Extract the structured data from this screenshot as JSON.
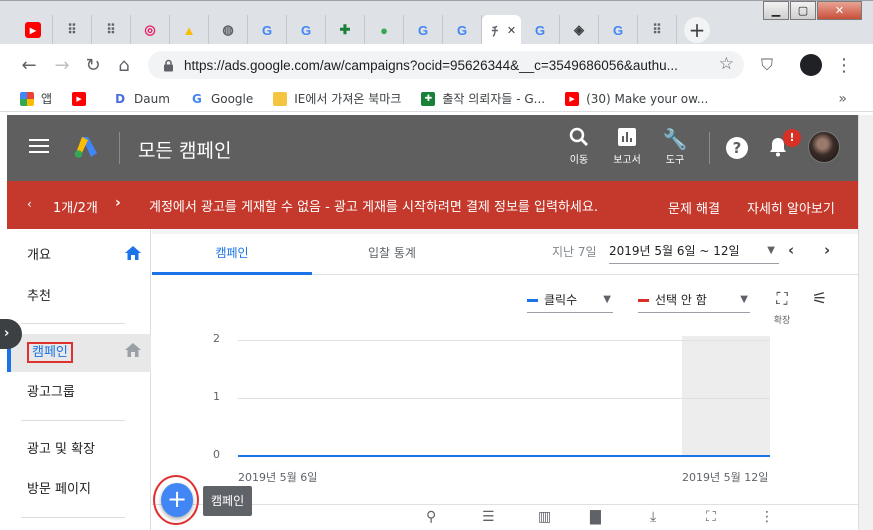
{
  "browser": {
    "tabs": [
      {
        "icon": "youtube-icon",
        "color": "#ff0000",
        "glyph": "▶"
      },
      {
        "icon": "dots-app-icon",
        "color": "#5f6368",
        "glyph": "⠿"
      },
      {
        "icon": "dots-app-icon",
        "color": "#5f6368",
        "glyph": "⠿"
      },
      {
        "icon": "target-icon",
        "color": "#e91e63",
        "glyph": "◎"
      },
      {
        "icon": "google-ads-icon",
        "color": "#fbbc04",
        "glyph": "▲"
      },
      {
        "icon": "globe-icon",
        "color": "#5f6368",
        "glyph": "◍"
      },
      {
        "icon": "google-icon",
        "color": "#4285f4",
        "glyph": "G"
      },
      {
        "icon": "google-icon",
        "color": "#4285f4",
        "glyph": "G"
      },
      {
        "icon": "cross-icon",
        "color": "#188038",
        "glyph": "✚"
      },
      {
        "icon": "green-app-icon",
        "color": "#34a853",
        "glyph": "●"
      },
      {
        "icon": "google-icon",
        "color": "#4285f4",
        "glyph": "G"
      },
      {
        "icon": "google-icon",
        "color": "#4285f4",
        "glyph": "G"
      },
      {
        "icon": "ads-tab-icon",
        "color": "#5f6368",
        "glyph": "ﾁ",
        "active": true
      },
      {
        "icon": "google-icon",
        "color": "#4285f4",
        "glyph": "G"
      },
      {
        "icon": "cube-icon",
        "color": "#3c4043",
        "glyph": "◈"
      },
      {
        "icon": "google-icon",
        "color": "#4285f4",
        "glyph": "G"
      },
      {
        "icon": "dots-app-icon",
        "color": "#5f6368",
        "glyph": "⠿"
      }
    ],
    "url": "https://ads.google.com/aw/campaigns?ocid=95626344&__c=3549686056&authu...",
    "bookmarks": [
      {
        "label": "앱",
        "icon": "apps-grid-icon",
        "color": "#ea4335"
      },
      {
        "label": "",
        "icon": "youtube-icon",
        "color": "#ff0000"
      },
      {
        "label": "Daum",
        "icon": "daum-icon",
        "color": "#4a6ee0"
      },
      {
        "label": "Google",
        "icon": "google-icon",
        "color": "#4285f4"
      },
      {
        "label": "IE에서 가져온 북마크",
        "icon": "folder-icon",
        "color": "#f5c542"
      },
      {
        "label": "출작 의뢰자들 - G...",
        "icon": "cross-icon",
        "color": "#188038"
      },
      {
        "label": "(30) Make your ow...",
        "icon": "youtube-icon",
        "color": "#ff0000"
      }
    ]
  },
  "header": {
    "title": "모든 캠페인",
    "nav": [
      {
        "label": "이동",
        "icon": "search-icon"
      },
      {
        "label": "보고서",
        "icon": "reports-icon"
      },
      {
        "label": "도구",
        "icon": "wrench-icon"
      }
    ],
    "notification_badge": "!"
  },
  "alert": {
    "counter": "1개/2개",
    "message": "계정에서 광고를 게재할 수 없음 - 광고 게재를 시작하려면 결제 정보를 입력하세요.",
    "action_fix": "문제 해결",
    "action_learn": "자세히 알아보기"
  },
  "sidebar": {
    "items": [
      {
        "label": "개요"
      },
      {
        "label": "추천"
      },
      {
        "label": "캠페인"
      },
      {
        "label": "광고그룹"
      },
      {
        "label": "광고 및 확장"
      },
      {
        "label": "방문 페이지"
      }
    ]
  },
  "content": {
    "tabs": [
      {
        "label": "캠페인"
      },
      {
        "label": "입찰 통계"
      }
    ],
    "date_prefix": "지난 7일",
    "date_range": "2019년 5월 6일 ~ 12일",
    "metric1": "클릭수",
    "metric1_color": "#1a73e8",
    "metric2": "선택 안 함",
    "metric2_color": "#d93025",
    "expand_label": "확장",
    "fab_tooltip": "캠페인"
  },
  "chart_data": {
    "type": "line",
    "x": [
      "2019년 5월 6일",
      "2019년 5월 12일"
    ],
    "series": [
      {
        "name": "클릭수",
        "values": [
          0,
          0
        ]
      }
    ],
    "yticks": [
      "2",
      "1",
      "0"
    ],
    "ylim": [
      0,
      2
    ],
    "grid": true
  }
}
